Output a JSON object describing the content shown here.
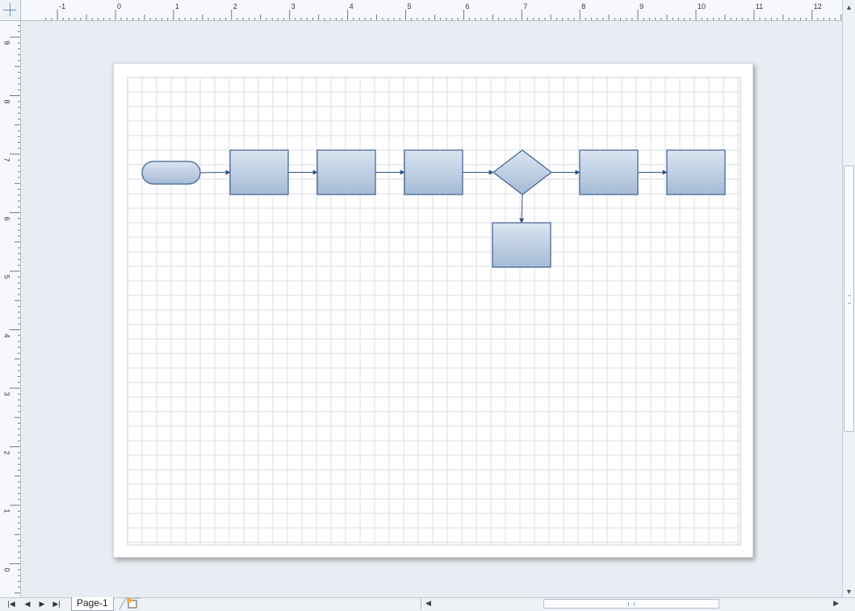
{
  "rulers": {
    "horizontal_labels": [
      "-1",
      "0",
      "1",
      "2",
      "3",
      "4",
      "5",
      "6",
      "7",
      "8",
      "9",
      "10",
      "11",
      "12"
    ],
    "vertical_labels": [
      "9",
      "8",
      "7",
      "6",
      "5",
      "4",
      "3",
      "2",
      "1",
      "0"
    ]
  },
  "page_tabs": {
    "active_tab": "Page-1"
  },
  "colors": {
    "shape_fill_top": "#dbe5f1",
    "shape_fill_bottom": "#a5bad6",
    "shape_stroke": "#3f5f8e",
    "connector": "#2f4f7f",
    "grid_line": "#d8dde5"
  },
  "diagram": {
    "shapes": [
      {
        "id": "start",
        "kind": "terminator"
      },
      {
        "id": "p1",
        "kind": "process"
      },
      {
        "id": "p2",
        "kind": "process"
      },
      {
        "id": "p3",
        "kind": "process"
      },
      {
        "id": "d1",
        "kind": "decision"
      },
      {
        "id": "p4",
        "kind": "process"
      },
      {
        "id": "p5",
        "kind": "process"
      },
      {
        "id": "p6",
        "kind": "process"
      }
    ],
    "connectors": [
      {
        "from": "start",
        "to": "p1"
      },
      {
        "from": "p1",
        "to": "p2"
      },
      {
        "from": "p2",
        "to": "p3"
      },
      {
        "from": "p3",
        "to": "d1"
      },
      {
        "from": "d1",
        "to": "p4"
      },
      {
        "from": "p4",
        "to": "p5"
      },
      {
        "from": "d1",
        "to": "p6"
      }
    ]
  }
}
